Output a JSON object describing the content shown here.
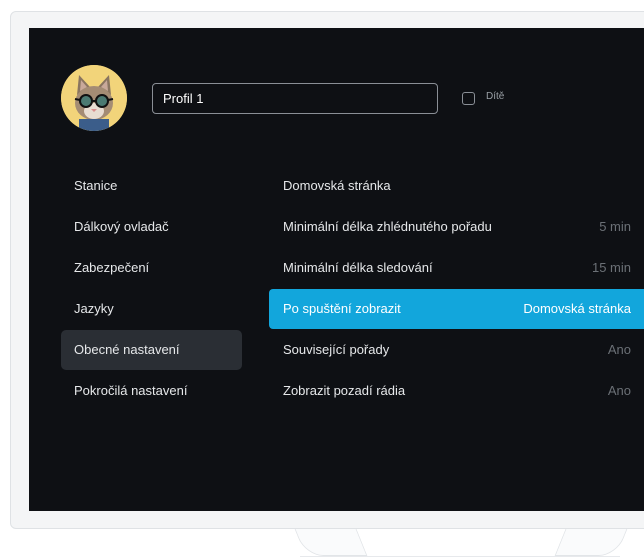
{
  "profile": {
    "name_value": "Profil 1",
    "child_label": "Dítě",
    "child_checked": false
  },
  "menu": {
    "items": [
      {
        "label": "Stanice"
      },
      {
        "label": "Dálkový ovladač"
      },
      {
        "label": "Zabezpečení"
      },
      {
        "label": "Jazyky"
      },
      {
        "label": "Obecné nastavení",
        "active": true
      },
      {
        "label": "Pokročilá nastavení"
      }
    ]
  },
  "settings": {
    "rows": [
      {
        "label": "Domovská stránka",
        "value": ""
      },
      {
        "label": "Minimální délka zhlédnutého pořadu",
        "value": "5 min"
      },
      {
        "label": "Minimální délka sledování",
        "value": "15 min"
      },
      {
        "label": "Po spuštění zobrazit",
        "value": "Domovská stránka",
        "highlighted": true
      },
      {
        "label": "Související pořady",
        "value": "Ano"
      },
      {
        "label": "Zobrazit pozadí rádia",
        "value": "Ano"
      }
    ]
  },
  "colors": {
    "screen_bg": "#0e1014",
    "accent": "#12a6dc",
    "active_menu_bg": "#2a2e34"
  }
}
